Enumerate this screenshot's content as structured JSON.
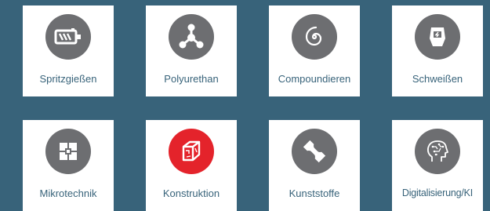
{
  "colors": {
    "background": "#38637a",
    "icon_circle": "#6d6e71",
    "icon_circle_active": "#e4232b",
    "label_text": "#38637a"
  },
  "tiles": [
    {
      "label": "Spritzgießen",
      "icon": "screw-icon"
    },
    {
      "label": "Polyurethan",
      "icon": "molecule-icon"
    },
    {
      "label": "Compoundieren",
      "icon": "spiral-icon"
    },
    {
      "label": "Schweißen",
      "icon": "welding-mask-icon"
    },
    {
      "label": "Mikrotechnik",
      "icon": "micro-grid-icon"
    },
    {
      "label": "Konstruktion",
      "icon": "cube-icon"
    },
    {
      "label": "Kunststoffe",
      "icon": "test-specimen-icon"
    },
    {
      "label": "Digitalisierung/KI",
      "icon": "ai-head-icon"
    }
  ]
}
